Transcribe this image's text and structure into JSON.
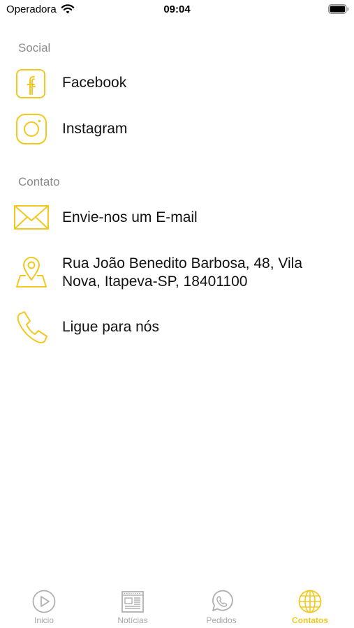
{
  "status_bar": {
    "carrier": "Operadora",
    "time": "09:04"
  },
  "colors": {
    "accent": "#f2c81e",
    "section_header": "#8a8a8a",
    "tab_inactive": "#a8a8a8"
  },
  "social": {
    "header": "Social",
    "items": [
      {
        "label": "Facebook",
        "icon": "facebook-icon"
      },
      {
        "label": "Instagram",
        "icon": "instagram-icon"
      }
    ]
  },
  "contact": {
    "header": "Contato",
    "items": [
      {
        "label": "Envie-nos um E-mail",
        "icon": "mail-icon"
      },
      {
        "label": "Rua João Benedito Barbosa, 48, Vila Nova, Itapeva-SP, 18401100",
        "icon": "map-pin-icon"
      },
      {
        "label": "Ligue para nós",
        "icon": "phone-icon"
      }
    ]
  },
  "tab_bar": {
    "active": "Contatos",
    "tabs": [
      {
        "label": "Inicio",
        "icon": "play-icon"
      },
      {
        "label": "Notícias",
        "icon": "newspaper-icon"
      },
      {
        "label": "Pedidos",
        "icon": "whatsapp-icon"
      },
      {
        "label": "Contatos",
        "icon": "globe-icon"
      }
    ]
  }
}
